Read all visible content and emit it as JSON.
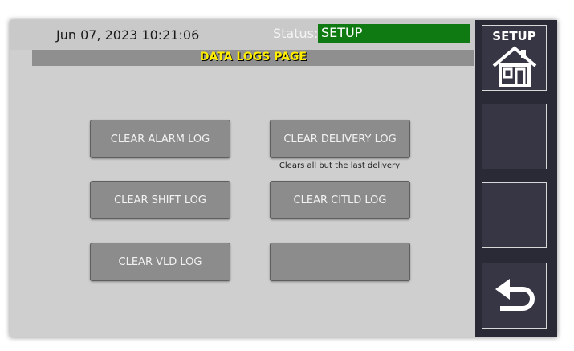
{
  "header": {
    "datetime": "Jun 07, 2023 10:21:06",
    "status_label": "Status:",
    "status_value": "SETUP"
  },
  "page": {
    "title": "DATA LOGS PAGE"
  },
  "buttons": {
    "clear_alarm_log": "CLEAR ALARM LOG",
    "clear_delivery_log": "CLEAR DELIVERY LOG",
    "delivery_note": "Clears all but the last delivery",
    "clear_shift_log": "CLEAR SHIFT LOG",
    "clear_citld_log": "CLEAR CITLD LOG",
    "clear_vld_log": "CLEAR VLD LOG",
    "blank_button": ""
  },
  "sidebar": {
    "setup_label": "SETUP",
    "setup_icon": "home-icon",
    "back_icon": "back-arrow-icon"
  },
  "colors": {
    "status_green": "#0f7a12",
    "title_yellow": "#ffee00",
    "sidebar_bg": "#2a2a36"
  }
}
